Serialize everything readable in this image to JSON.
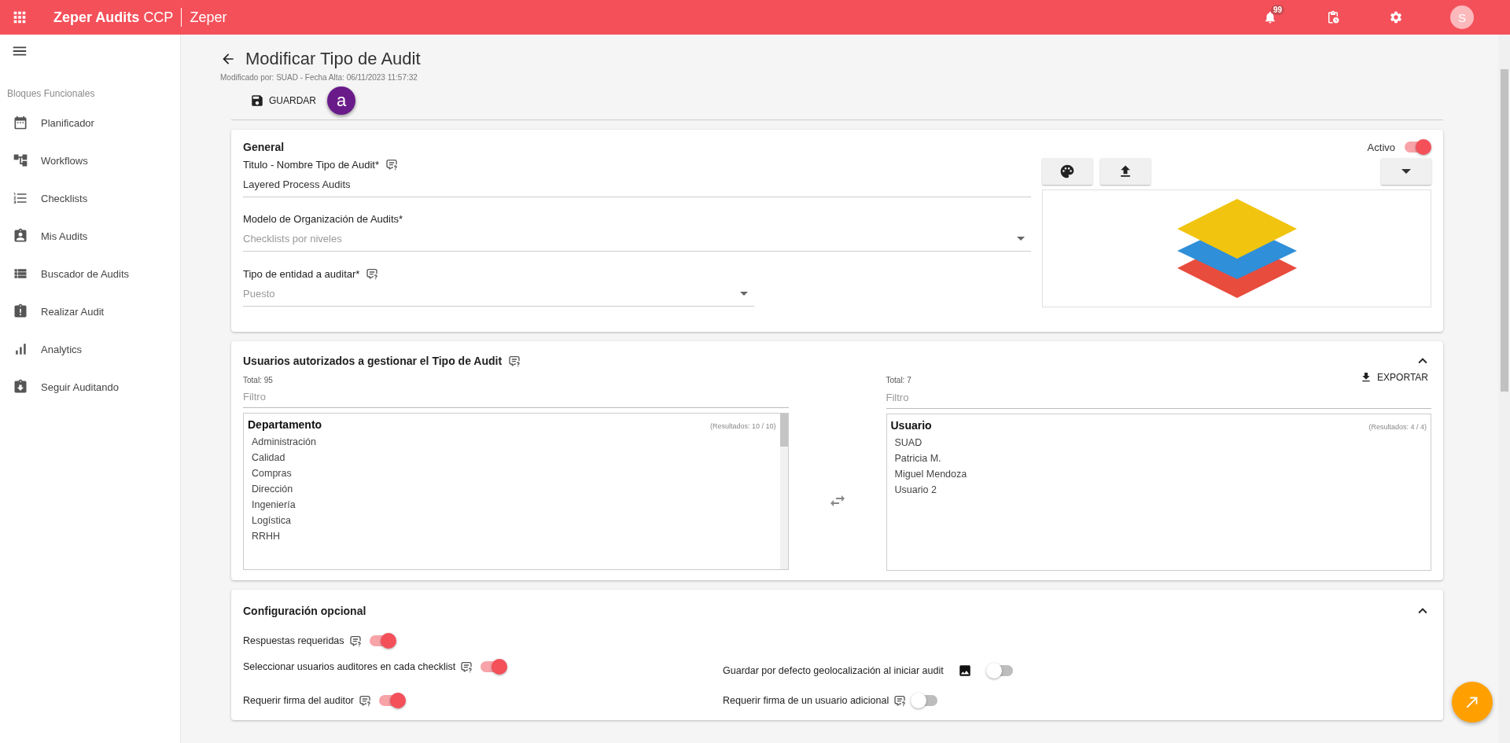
{
  "topbar": {
    "app_name": "Zeper Audits",
    "app_suffix": "CCP",
    "company": "Zeper",
    "notifications_count": "99",
    "avatar": "S"
  },
  "sidebar": {
    "section_title": "Bloques Funcionales",
    "items": [
      {
        "kind": "calendar",
        "label": "Planificador"
      },
      {
        "kind": "tree",
        "label": "Workflows"
      },
      {
        "kind": "list",
        "label": "Checklists"
      },
      {
        "kind": "person",
        "label": "Mis Audits"
      },
      {
        "kind": "rows",
        "label": "Buscador de Audits"
      },
      {
        "kind": "alert",
        "label": "Realizar Audit"
      },
      {
        "kind": "bars",
        "label": "Analytics"
      },
      {
        "kind": "download",
        "label": "Seguir Auditando"
      }
    ]
  },
  "header": {
    "title": "Modificar Tipo de Audit",
    "subtitle": "Modificado por: SUAD - Fecha Alta: 06/11/2023 11:57:32",
    "save_label": "GUARDAR",
    "annotation": "a"
  },
  "general": {
    "title": "General",
    "active_label": "Activo",
    "active": true,
    "fields": [
      {
        "kind": "text",
        "label": "Titulo - Nombre Tipo de Audit*",
        "help": true,
        "value": "Layered Process Audits",
        "disabled": false
      },
      {
        "kind": "select",
        "label": "Modelo de Organización de Audits*",
        "help": false,
        "value": "Checklists por niveles",
        "disabled": true
      },
      {
        "kind": "select",
        "label": "Tipo de entidad a auditar*",
        "help": true,
        "value": "Puesto",
        "disabled": true
      }
    ]
  },
  "users": {
    "title": "Usuarios autorizados a gestionar el Tipo de Audit",
    "expanded": true,
    "left": {
      "total": "Total: 95",
      "filter_placeholder": "Filtro",
      "heading": "Departamento",
      "results": "(Resultados: 10 / 10)",
      "items": [
        "Administración",
        "Calidad",
        "Compras",
        "Dirección",
        "Ingeniería",
        "Logística",
        "RRHH"
      ]
    },
    "right": {
      "total": "Total: 7",
      "filter_placeholder": "Filtro",
      "export_label": "EXPORTAR",
      "heading": "Usuario",
      "results": "(Resultados: 4 / 4)",
      "items": [
        "SUAD",
        "Patricia M.",
        "Miguel Mendoza",
        "Usuario 2"
      ]
    }
  },
  "config": {
    "title": "Configuración opcional",
    "expanded": true,
    "rows": [
      {
        "left": {
          "label": "Respuestas requeridas",
          "kind": "help",
          "on": true
        }
      },
      {
        "left": {
          "label": "Seleccionar usuarios auditores en cada checklist",
          "kind": "help",
          "on": true
        },
        "right": {
          "label": "Guardar por defecto geolocalización al iniciar audit",
          "kind": "image",
          "on": false
        }
      },
      {
        "left": {
          "label": "Requerir firma del auditor",
          "kind": "help",
          "on": true
        },
        "right": {
          "label": "Requerir firma de un usuario adicional",
          "kind": "help",
          "on": false
        }
      }
    ]
  }
}
